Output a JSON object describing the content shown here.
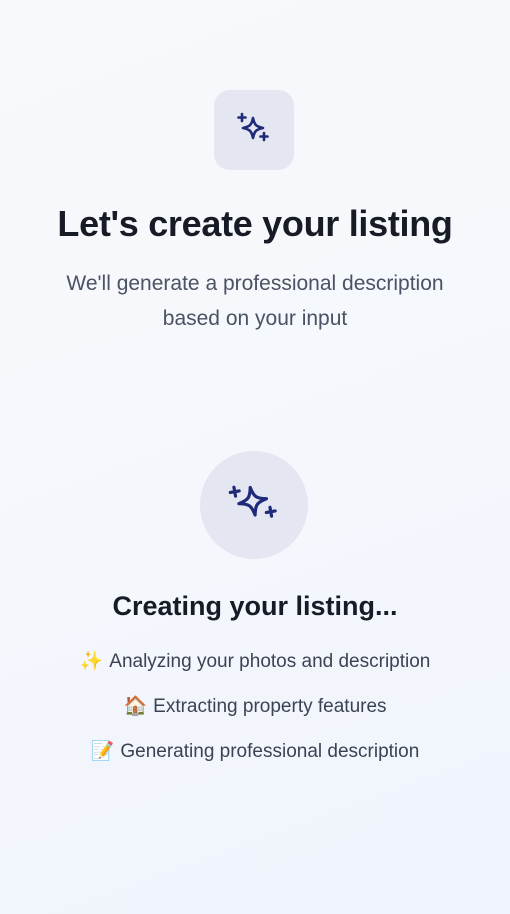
{
  "header": {
    "icon": "sparkles-icon",
    "title": "Let's create your listing",
    "subtitle": "We'll generate a professional description based on your input"
  },
  "status": {
    "icon": "sparkles-icon",
    "title": "Creating your listing...",
    "steps": [
      {
        "emoji": "✨",
        "text": "Analyzing your photos and description"
      },
      {
        "emoji": "🏠",
        "text": "Extracting property features"
      },
      {
        "emoji": "📝",
        "text": "Generating professional description"
      }
    ]
  },
  "colors": {
    "accent": "#1f2a7a",
    "tile": "#e4e6f1",
    "title": "#161b26",
    "muted": "#4a5263"
  }
}
